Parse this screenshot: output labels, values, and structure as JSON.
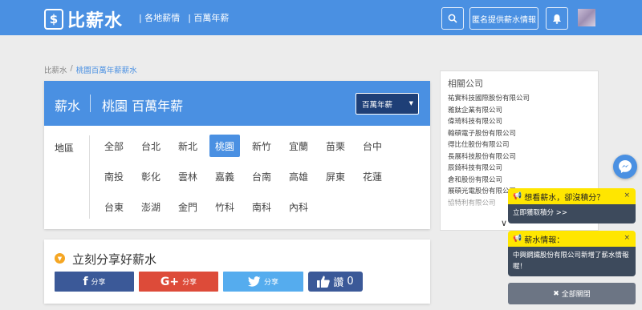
{
  "header": {
    "logo_icon": "$",
    "logo_text": "比薪水",
    "nav": [
      "| 各地薪情",
      "| 百萬年薪"
    ],
    "anon_button": "匿名提供薪水情報",
    "search_icon": "search-icon",
    "bell_icon": "bell-icon",
    "brand_color": "#4a90e2"
  },
  "breadcrumb": {
    "home": "比薪水",
    "separator": "/",
    "current": "桃園百萬年薪薪水"
  },
  "main": {
    "head_label": "薪水",
    "head_title": "桃園 百萬年薪",
    "select_value": "百萬年薪",
    "area_label": "地區",
    "regions": [
      "全部",
      "台北",
      "新北",
      "桃園",
      "新竹",
      "宜蘭",
      "苗栗",
      "台中",
      "南投",
      "彰化",
      "雲林",
      "嘉義",
      "台南",
      "高雄",
      "屏東",
      "花蓮",
      "台東",
      "澎湖",
      "金門",
      "竹科",
      "南科",
      "內科"
    ],
    "active_region": "桃園"
  },
  "share": {
    "title": "立刻分享好薪水",
    "facebook_glyph": "f",
    "facebook": "分享",
    "google_glyph": "G+",
    "google": "分享",
    "twitter": "分享",
    "like_label": "讚",
    "like_count": "0",
    "colors": {
      "facebook": "#3b5998",
      "google": "#dd4b39",
      "twitter": "#55acee"
    }
  },
  "related": {
    "title": "相關公司",
    "companies": [
      "祐實科技國際股份有限公司",
      "雅鈦企業有限公司",
      "偉琦科技有限公司",
      "翰碩電子股份有限公司",
      "得比仕股份有限公司",
      "長展科技股份有限公司",
      "辰錡科技有限公司",
      "倉和股份有限公司",
      "展碩光電股份有限公司",
      "協特利有限公司"
    ]
  },
  "notifications": [
    {
      "title": "想看薪水，卻沒積分？",
      "body": "立即獲取積分 >>",
      "close": "×"
    },
    {
      "title": "薪水情報：",
      "body": "中興鋼鐵股份有限公司新增了薪水情報喔！",
      "close": "×"
    }
  ],
  "close_all": "全部關閉"
}
